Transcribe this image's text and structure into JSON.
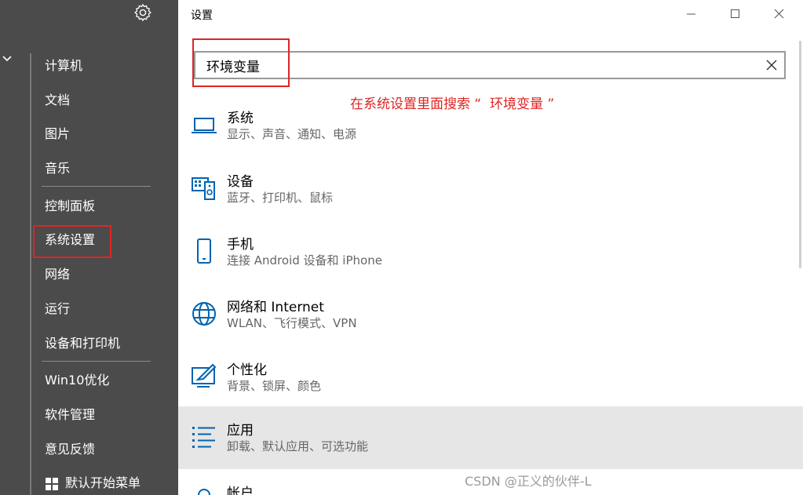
{
  "left_menu": {
    "items": [
      "计算机",
      "文档",
      "图片",
      "音乐",
      "控制面板",
      "系统设置",
      "网络",
      "运行",
      "设备和打印机",
      "Win10优化",
      "软件管理",
      "意见反馈",
      "默认开始菜单"
    ]
  },
  "window": {
    "title": "设置"
  },
  "search": {
    "value": "环境变量"
  },
  "annotation": "在系统设置里面搜索 “  环境变量 ”",
  "results": [
    {
      "title": "系统",
      "subtitle": "显示、声音、通知、电源",
      "icon": "laptop-icon"
    },
    {
      "title": "设备",
      "subtitle": "蓝牙、打印机、鼠标",
      "icon": "devices-icon"
    },
    {
      "title": "手机",
      "subtitle": "连接 Android 设备和 iPhone",
      "icon": "phone-icon"
    },
    {
      "title": "网络和 Internet",
      "subtitle": "WLAN、飞行模式、VPN",
      "icon": "globe-icon"
    },
    {
      "title": "个性化",
      "subtitle": "背景、锁屏、颜色",
      "icon": "personalization-icon"
    },
    {
      "title": "应用",
      "subtitle": "卸载、默认应用、可选功能",
      "icon": "apps-list-icon"
    },
    {
      "title": "帐户",
      "subtitle": "",
      "icon": "account-icon"
    }
  ],
  "watermark": "CSDN @正义的伙伴-L",
  "colors": {
    "sidebar_bg": "#4b4b4b",
    "accent": "#0063b1",
    "highlight_red": "#e02424",
    "selected_row": "#e6e6e6"
  }
}
